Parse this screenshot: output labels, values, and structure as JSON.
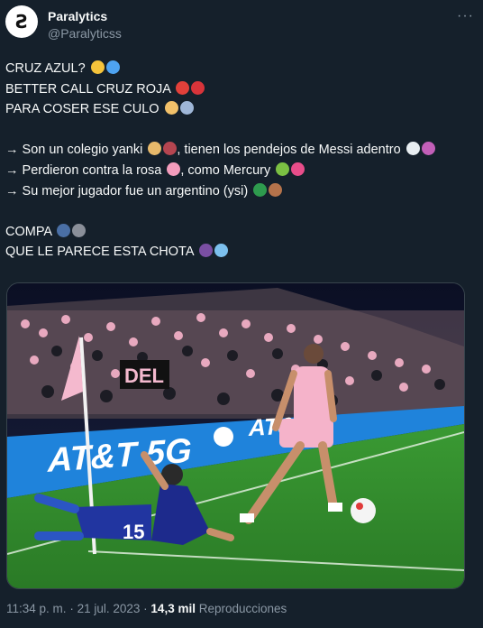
{
  "author": {
    "name": "Paralytics",
    "handle": "@Paralyticss",
    "avatar_letter": "Ƨ"
  },
  "tweet_lines": [
    {
      "text": "CRUZ AZUL?",
      "emojis": [
        "thinking-face",
        "blue-circle"
      ]
    },
    {
      "text": "BETTER CALL CRUZ ROJA",
      "emojis": [
        "rescue-helmet",
        "telephone"
      ]
    },
    {
      "text": "PARA COSER ESE CULO",
      "emojis": [
        "health-worker",
        "syringe"
      ]
    },
    {
      "text": "",
      "emojis": []
    },
    {
      "text": "→ Son un colegio yanki",
      "emojis": [
        "school",
        "us-flag"
      ],
      "text2": ", tienen los pendejos de Messi adentro",
      "emojis2": [
        "milk-glass",
        "devil-face"
      ]
    },
    {
      "text": "→ Perdieron contra la rosa",
      "emojis": [
        "pink-heart"
      ],
      "text2": ", como Mercury",
      "emojis2": [
        "microbe",
        "rainbow-flag"
      ]
    },
    {
      "text": "→ Su mejor jugador fue un argentino (ysi)",
      "emojis": [
        "mexico-flag",
        "muscle-arm"
      ]
    },
    {
      "text": "",
      "emojis": []
    },
    {
      "text": "COMPA",
      "emojis": [
        "speaking-head",
        "microphone"
      ]
    },
    {
      "text": "QUE LE PARECE ESTA CHOTA",
      "emojis": [
        "eggplant",
        "argentina-flag"
      ]
    }
  ],
  "image": {
    "banner_text": "AT&T 5G",
    "banner_text2": "AT&",
    "stand_sign": "DEL",
    "player_number": "15",
    "colors": {
      "pink": "#f4b9ce",
      "banner_blue": "#1a7ed6",
      "grass": "#2f8a2c",
      "away_blue": "#1d2a8c"
    }
  },
  "meta": {
    "time": "11:34 p. m.",
    "separator": "·",
    "date": "21 jul. 2023",
    "views": "14,3 mil",
    "views_label": "Reproducciones"
  }
}
